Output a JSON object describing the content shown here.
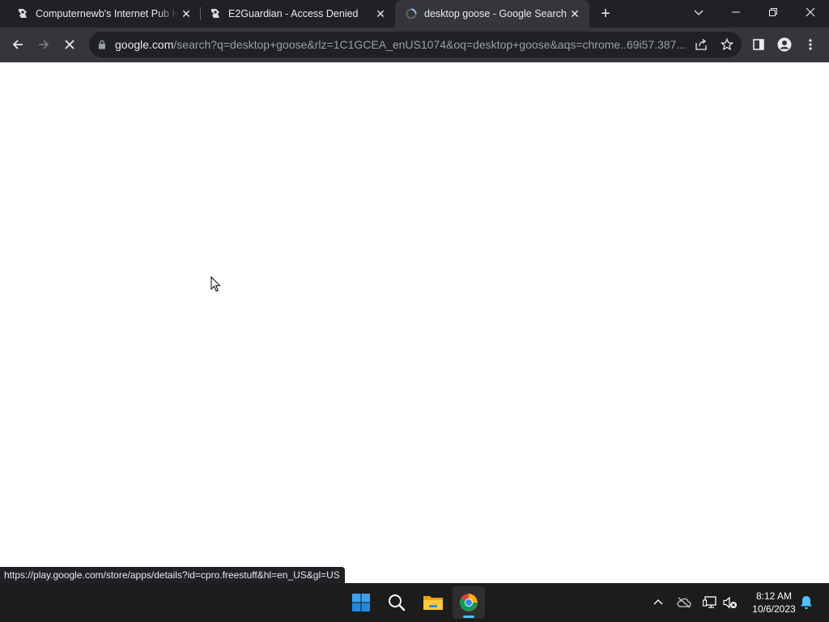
{
  "browser": {
    "tabs": [
      {
        "title": "Computernewb's Internet Pub Hub",
        "favicon": "computernewb-icon",
        "active": false
      },
      {
        "title": "E2Guardian - Access Denied",
        "favicon": "e2guardian-icon",
        "active": false
      },
      {
        "title": "desktop goose - Google Search",
        "favicon": "loading-spinner-icon",
        "active": true
      }
    ],
    "new_tab_label": "+",
    "address_bar": {
      "host": "google.com",
      "path": "/search?q=desktop+goose&rlz=1C1GCEA_enUS1074&oq=desktop+goose&aqs=chrome..69i57.387..."
    },
    "status_url": "https://play.google.com/store/apps/details?id=cpro.freestuff&hl=en_US&gl=US"
  },
  "taskbar": {
    "apps": [
      "windows-start-icon",
      "search-icon",
      "file-explorer-icon",
      "chrome-icon"
    ],
    "clock": {
      "time": "8:12 AM",
      "date": "10/6/2023"
    }
  },
  "colors": {
    "tabstrip": "#202124",
    "toolbar": "#35363a",
    "taskbar": "#1c1c1c",
    "accent": "#4cc2ff"
  }
}
